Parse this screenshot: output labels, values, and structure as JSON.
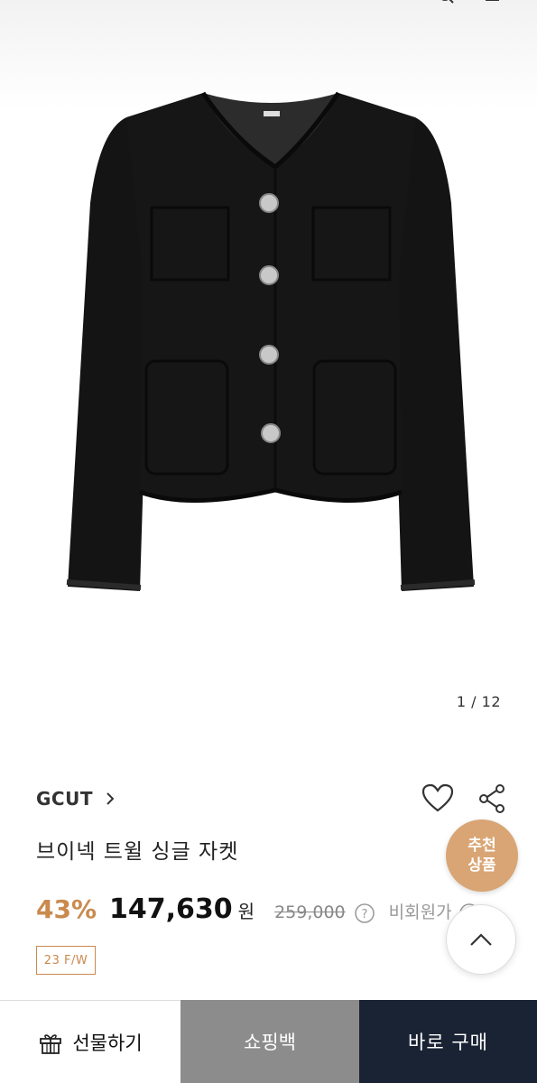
{
  "gallery": {
    "pager": "1 / 12",
    "image_description_icon": "jacket-image"
  },
  "product": {
    "brand": "GCUT",
    "title": "브이넥 트윌 싱글 자켓",
    "discount": "43%",
    "price": "147,630",
    "currency": "원",
    "original_price": "259,000",
    "member_label": "비회원가",
    "season": "23 F/W"
  },
  "floating": {
    "recommend_line1": "추천",
    "recommend_line2": "상품"
  },
  "bottom_bar": {
    "gift_label": "선물하기",
    "bag_label": "쇼핑백",
    "buy_label": "바로 구매"
  },
  "colors": {
    "accent": "#c98a4e",
    "recommend_bg": "#d9a574",
    "bag_bg": "#8c8c8c",
    "buy_bg": "#1a2333"
  }
}
